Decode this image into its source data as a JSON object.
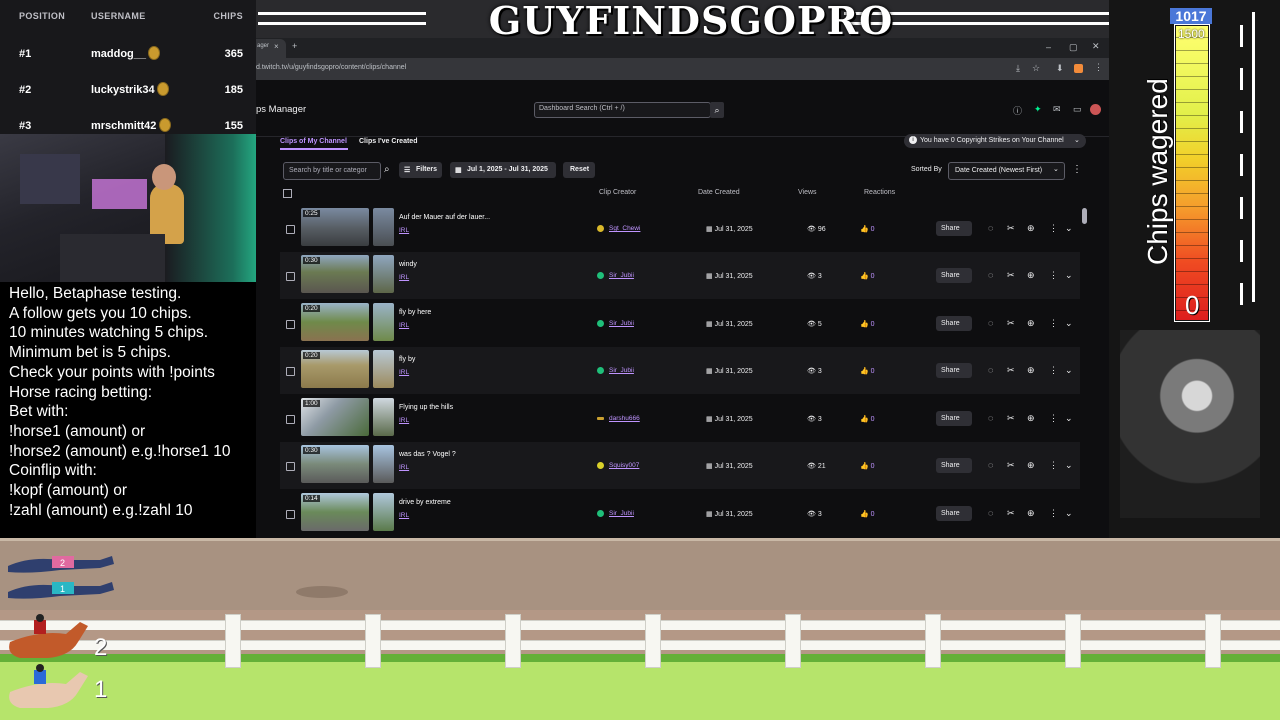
{
  "stream": {
    "title": "GUYFINDSGOPRO"
  },
  "leaderboard": {
    "headers": {
      "position": "POSITION",
      "username": "USERNAME",
      "chips": "CHIPS"
    },
    "rows": [
      {
        "position": "#1",
        "username": "maddog__",
        "chips": "365"
      },
      {
        "position": "#2",
        "username": "luckystrik34",
        "chips": "185"
      },
      {
        "position": "#3",
        "username": "mrschmitt42",
        "chips": "155"
      }
    ]
  },
  "info": {
    "lines": [
      "Hello, Betaphase testing.",
      "A follow gets you 10 chips.",
      "10 minutes watching 5 chips.",
      "Minimum bet is 5 chips.",
      "Check your points with !points",
      "Horse racing betting:",
      "Bet with:",
      "!horse1 (amount) or",
      "!horse2 (amount) e.g.!horse1 10",
      "Coinflip with:",
      "!kopf (amount) or",
      "!zahl (amount) e.g.!zahl 10"
    ]
  },
  "browser": {
    "tab_label": "ager",
    "url": "d.twitch.tv/u/guyfindsgopro/content/clips/channel",
    "page_title": "ps Manager",
    "search_placeholder": "Dashboard Search (Ctrl + /)"
  },
  "clips": {
    "tabs": [
      "Clips of My Channel",
      "Clips I've Created"
    ],
    "copyright_notice": "You have 0 Copyright Strikes on Your Channel",
    "filter_placeholder": "Search by title or categor",
    "filters_label": "Filters",
    "date_range": "Jul 1, 2025 - Jul 31, 2025",
    "reset_label": "Reset",
    "sorted_by_label": "Sorted By",
    "sort_value": "Date Created (Newest First)",
    "columns": {
      "creator": "Clip Creator",
      "date": "Date Created",
      "views": "Views",
      "reactions": "Reactions"
    },
    "share_label": "Share",
    "rows": [
      {
        "duration": "0:25",
        "title": "Auf der Mauer auf der lauer...",
        "category": "IRL",
        "creator": "Sgt_Chewi",
        "date": "Jul 31, 2025",
        "views": "96",
        "reactions": "0"
      },
      {
        "duration": "0:30",
        "title": "windy",
        "category": "IRL",
        "creator": "Sir_Jubii",
        "date": "Jul 31, 2025",
        "views": "3",
        "reactions": "0"
      },
      {
        "duration": "0:20",
        "title": "fly by here",
        "category": "IRL",
        "creator": "Sir_Jubii",
        "date": "Jul 31, 2025",
        "views": "5",
        "reactions": "0"
      },
      {
        "duration": "0:20",
        "title": "fly by",
        "category": "IRL",
        "creator": "Sir_Jubii",
        "date": "Jul 31, 2025",
        "views": "3",
        "reactions": "0"
      },
      {
        "duration": "1:00",
        "title": "Flying up the hills",
        "category": "IRL",
        "creator": "darshu666",
        "date": "Jul 31, 2025",
        "views": "3",
        "reactions": "0"
      },
      {
        "duration": "0:30",
        "title": "was das ? Vogel ?",
        "category": "IRL",
        "creator": "Squisy007",
        "date": "Jul 31, 2025",
        "views": "21",
        "reactions": "0"
      },
      {
        "duration": "0:14",
        "title": "drive by extreme",
        "category": "IRL",
        "creator": "Sir_Jubii",
        "date": "Jul 31, 2025",
        "views": "3",
        "reactions": "0"
      }
    ]
  },
  "meter": {
    "value": "1017",
    "max_label": "1500",
    "min_label": "0",
    "label": "Chips wagered",
    "fill_fraction": 0.68
  },
  "race": {
    "lane_numbers": [
      "2",
      "1"
    ],
    "dog_numbers": [
      "2",
      "1"
    ]
  },
  "colors": {
    "accent": "#bf94ff",
    "meter_value_bg": "#4a77d8",
    "grass": "#b6e46b"
  }
}
